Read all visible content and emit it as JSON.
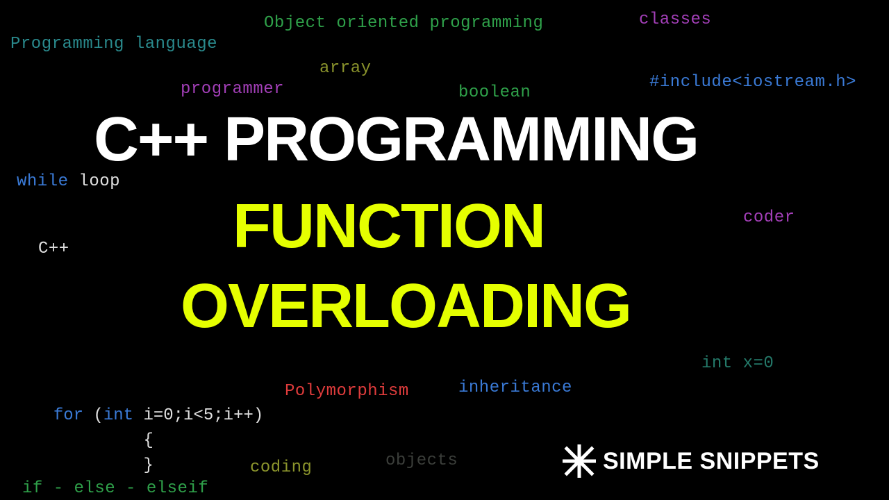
{
  "title_line1": "C++ PROGRAMMING",
  "title_line2": "FUNCTION",
  "title_line3": "OVERLOADING",
  "words": {
    "prog_lang": "Programming language",
    "oop": "Object oriented programming",
    "classes": "classes",
    "programmer": "programmer",
    "array": "array",
    "boolean": "boolean",
    "include": "#include<iostream.h>",
    "while": "while",
    "loop": " loop",
    "coder": "coder",
    "cpp": "C++",
    "intx": "int x=0",
    "inheritance": "inheritance",
    "polymorphism": "Polymorphism",
    "objects": "objects",
    "coding": "coding",
    "ifelse": "if - else - elseif"
  },
  "forloop": {
    "kw_for": "for ",
    "paren_open": "(",
    "kw_int": "int",
    "rest": " i=0;i<5;i++)",
    "brace_open": "{",
    "brace_close": "}"
  },
  "brand": "SIMPLE SNIPPETS"
}
